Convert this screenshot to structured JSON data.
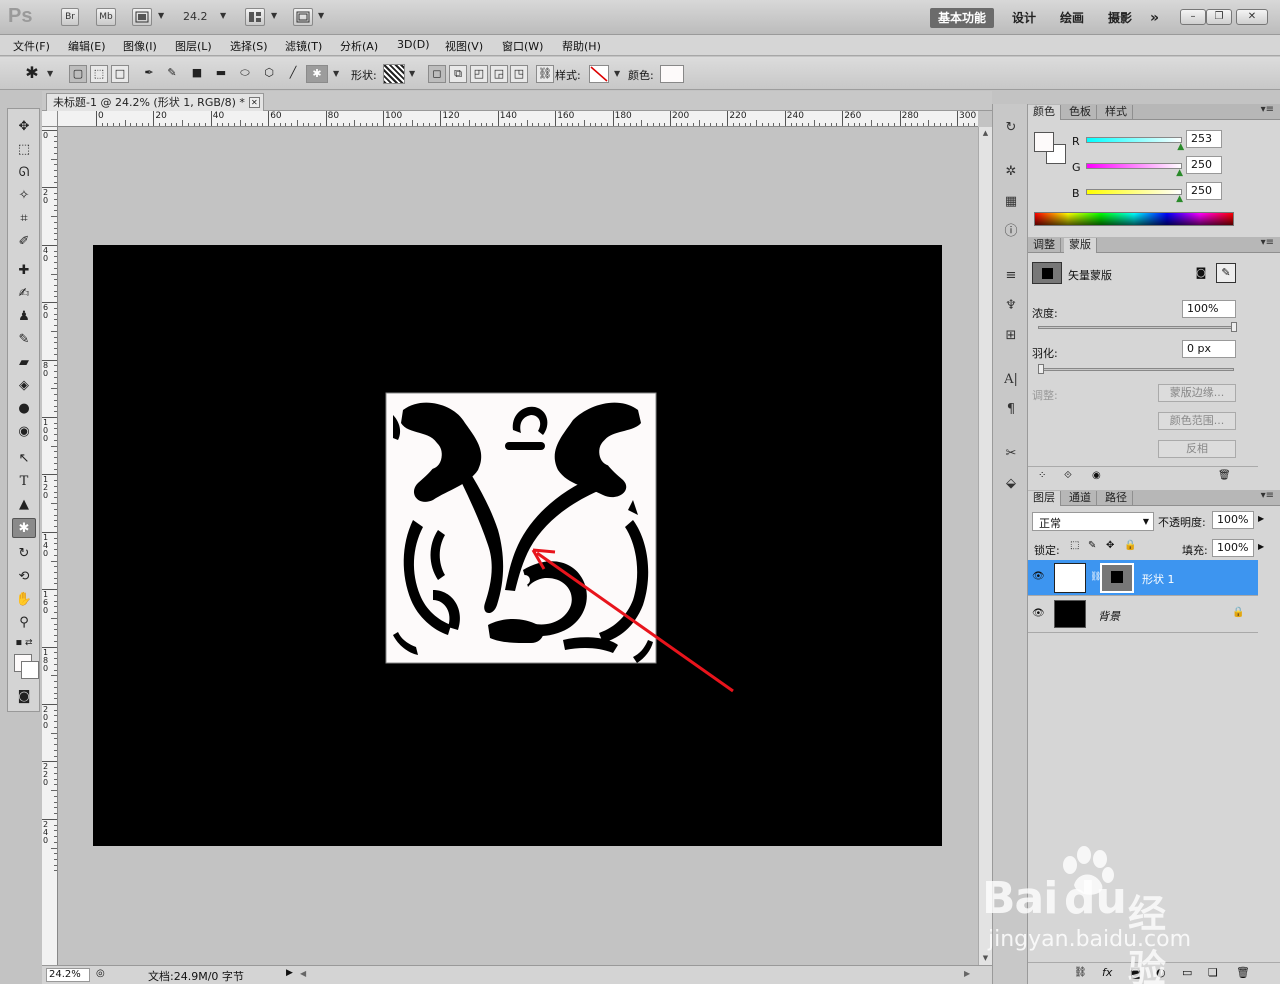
{
  "app": {
    "logo": "Ps",
    "bridge_label": "Br",
    "minibridge_label": "Mb",
    "zoom_value": "24.2",
    "workspaces": [
      "基本功能",
      "设计",
      "绘画",
      "摄影"
    ],
    "more_workspaces": "»"
  },
  "menu": [
    "文件(F)",
    "编辑(E)",
    "图像(I)",
    "图层(L)",
    "选择(S)",
    "滤镜(T)",
    "分析(A)",
    "3D(D)",
    "视图(V)",
    "窗口(W)",
    "帮助(H)"
  ],
  "options": {
    "shape_label": "形状:",
    "style_label": "样式:",
    "color_label": "颜色:",
    "color_value": "#fdfafa"
  },
  "document": {
    "tab_title": "未标题-1 @ 24.2% (形状 1, RGB/8) *",
    "ruler_ticks": [
      "0",
      "20",
      "40",
      "60",
      "80",
      "100",
      "120",
      "140",
      "160",
      "180",
      "200",
      "220",
      "240",
      "260",
      "280",
      "300"
    ],
    "vruler_ticks": [
      "0",
      "2\n0",
      "4\n0",
      "6\n0",
      "8\n0",
      "1\n0\n0",
      "1\n2\n0",
      "1\n4\n0",
      "1\n6\n0",
      "1\n8\n0",
      "2\n0\n0",
      "2\n2\n0",
      "2\n4\n0"
    ],
    "status_zoom": "24.2%",
    "status_doc": "文档:24.9M/0 字节"
  },
  "color_panel": {
    "tabs": [
      "颜色",
      "色板",
      "样式"
    ],
    "r_label": "R",
    "g_label": "G",
    "b_label": "B",
    "r_value": "253",
    "g_value": "250",
    "b_value": "250",
    "r": 253,
    "g": 250,
    "b": 250
  },
  "masks_panel": {
    "tabs": [
      "调整",
      "蒙版"
    ],
    "mask_type": "矢量蒙版",
    "density_label": "浓度:",
    "density_value": "100%",
    "density": 1.0,
    "feather_label": "羽化:",
    "feather_value": "0 px",
    "feather": 0,
    "refine_label": "调整:",
    "mask_edge_btn": "蒙版边缘...",
    "color_range_btn": "颜色范围...",
    "invert_btn": "反相"
  },
  "layers_panel": {
    "tabs": [
      "图层",
      "通道",
      "路径"
    ],
    "blend_mode": "正常",
    "opacity_label": "不透明度:",
    "opacity_value": "100%",
    "lock_label": "锁定:",
    "fill_label": "填充:",
    "fill_value": "100%",
    "layers": [
      {
        "name": "形状 1",
        "selected": true
      },
      {
        "name": "背景",
        "selected": false
      }
    ]
  },
  "watermark": {
    "brand": "Bai",
    "brand2": "du",
    "brand_cn": "经验",
    "url": "jingyan.baidu.com"
  },
  "colors": {
    "selection": "#3d95f0",
    "annotation_arrow": "#e8141c"
  }
}
